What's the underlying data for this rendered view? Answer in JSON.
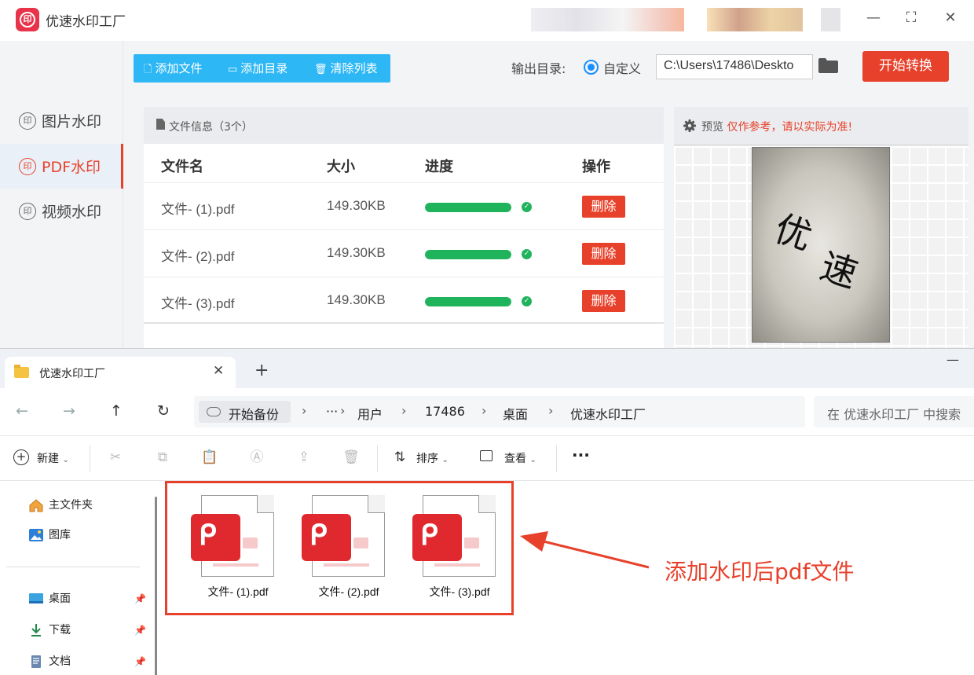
{
  "app": {
    "title": "优速水印工厂",
    "logo_glyph": "印",
    "window_controls": {
      "minimize": "—",
      "maximize": "⛶",
      "close": "✕"
    },
    "sidebar": [
      {
        "glyph": "印",
        "label": "图片水印"
      },
      {
        "glyph": "印",
        "label": "PDF水印",
        "active": true
      },
      {
        "glyph": "印",
        "label": "视频水印"
      }
    ],
    "toolbar": {
      "add_file": "添加文件",
      "add_dir": "添加目录",
      "clear_list": "清除列表"
    },
    "output": {
      "label": "输出目录:",
      "radio_label": "自定义",
      "path": "C:\\Users\\17486\\Deskto"
    },
    "start_button": "开始转换",
    "file_panel": {
      "title": "文件信息（3个）",
      "columns": {
        "name": "文件名",
        "size": "大小",
        "progress": "进度",
        "action": "操作"
      },
      "rows": [
        {
          "name": "文件- (1).pdf",
          "size": "149.30KB",
          "progress": 1.0,
          "action": "删除"
        },
        {
          "name": "文件- (2).pdf",
          "size": "149.30KB",
          "progress": 1.0,
          "action": "删除"
        },
        {
          "name": "文件- (3).pdf",
          "size": "149.30KB",
          "progress": 1.0,
          "action": "删除"
        }
      ]
    },
    "preview": {
      "label": "预览",
      "note": "仅作参考，请以实际为准!",
      "watermark_1": "优",
      "watermark_2": "速"
    }
  },
  "explorer": {
    "tab_title": "优速水印工厂",
    "tab_close": "✕",
    "new_tab": "+",
    "minimize": "—",
    "nav": {
      "back": "←",
      "forward": "→",
      "up": "↑",
      "refresh": "↻"
    },
    "address": {
      "backup": "开始备份",
      "more": "···",
      "crumbs": [
        "用户",
        "17486",
        "桌面",
        "优速水印工厂"
      ],
      "separator": "›"
    },
    "search_placeholder": "在 优速水印工厂 中搜索",
    "commands": {
      "new": "新建",
      "sort": "排序",
      "view": "查看",
      "more": "···"
    },
    "nav_pane": [
      {
        "label": "主文件夹",
        "icon": "home-icon"
      },
      {
        "label": "图库",
        "icon": "gallery-icon"
      },
      {
        "label": "桌面",
        "icon": "desktop-icon",
        "pinned": true
      },
      {
        "label": "下载",
        "icon": "download-icon",
        "pinned": true
      },
      {
        "label": "文档",
        "icon": "document-icon",
        "pinned": true
      }
    ],
    "files": [
      {
        "name": "文件- (1).pdf"
      },
      {
        "name": "文件- (2).pdf"
      },
      {
        "name": "文件- (3).pdf"
      }
    ]
  },
  "annotation": {
    "text": "添加水印后pdf文件"
  },
  "colors": {
    "accent": "#e8412b",
    "toolbar_blue": "#2db7f5",
    "progress_green": "#1fb35c"
  }
}
